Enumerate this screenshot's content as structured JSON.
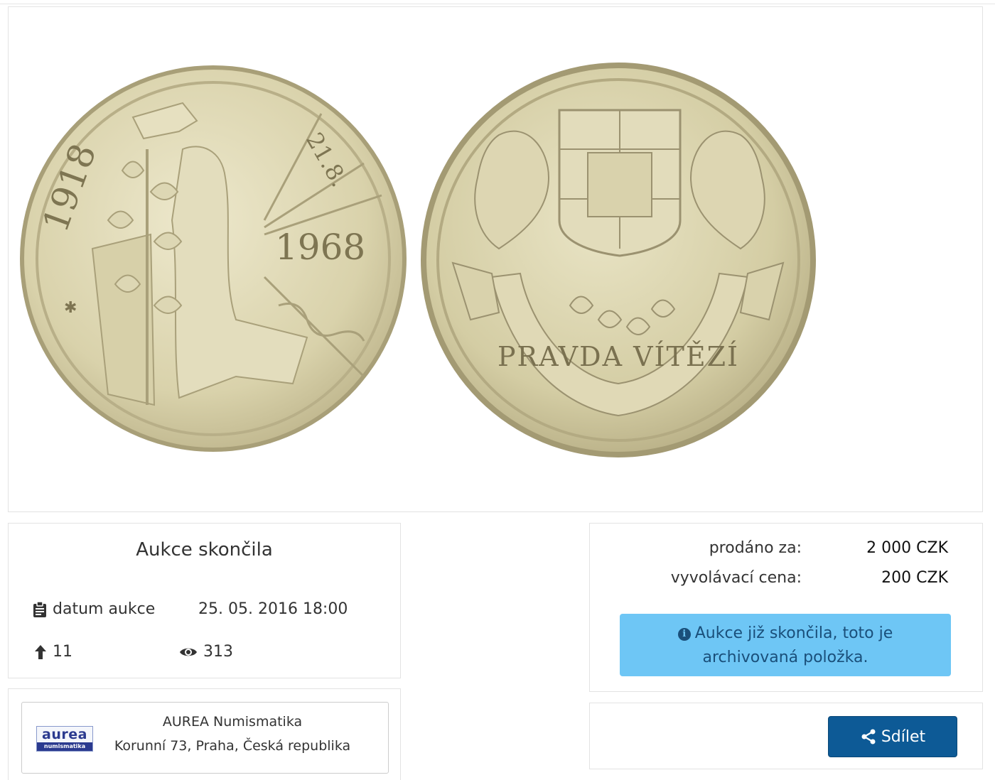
{
  "gallery": {
    "coin_obverse": {
      "year_left": "1918",
      "date_right": "21.8.",
      "year_center": "1968"
    },
    "coin_reverse": {
      "motto": "PRAVDA VÍTĚZÍ"
    }
  },
  "auction_status": {
    "title": "Aukce skončila",
    "date_label": "datum aukce",
    "date_value": "25. 05. 2016 18:00",
    "bids_count": "11",
    "views_count": "313",
    "icons": [
      "clipboard-icon",
      "arrow-up-icon",
      "eye-icon"
    ]
  },
  "seller": {
    "logo_text": "aurea",
    "logo_subtext": "numismatika",
    "name": "AUREA Numismatika",
    "address": "Korunní 73, Praha, Česká republika"
  },
  "pricing": {
    "sold_label": "prodáno za:",
    "sold_value": "2 000 CZK",
    "start_label": "vyvolávací cena:",
    "start_value": "200 CZK",
    "archive_notice": "Aukce již skončila, toto je archivovaná položka."
  },
  "share": {
    "button_label": "Sdílet"
  },
  "colors": {
    "accent_button": "#0d5a96",
    "alert_bg": "#6ec6f5",
    "coin_metal": "#ddd7b4"
  }
}
